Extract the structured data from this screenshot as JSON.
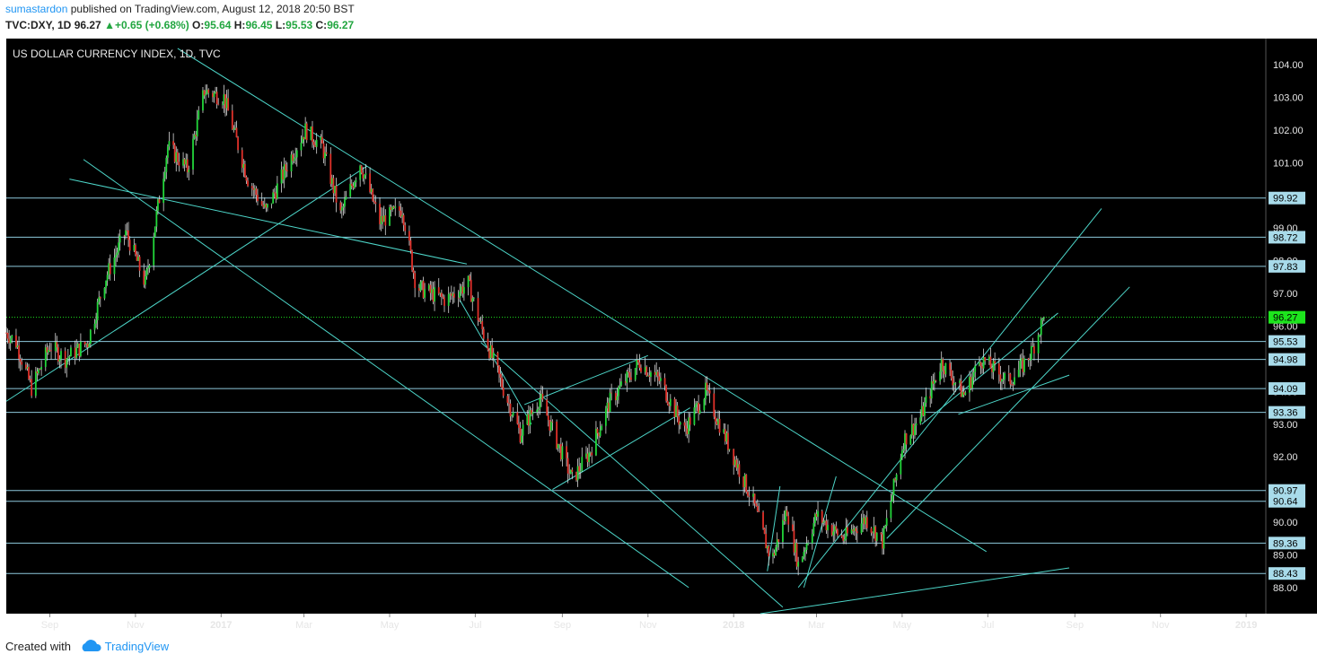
{
  "header": {
    "user": "sumastardon",
    "published_text": "published on TradingView.com, August 12, 2018 20:50 BST",
    "symbol": "TVC:DXY, 1D",
    "last": "96.27",
    "change": "+0.65 (+0.68%)",
    "o_label": "O:",
    "o": "95.64",
    "h_label": "H:",
    "h": "96.45",
    "l_label": "L:",
    "l": "95.53",
    "c_label": "C:",
    "c": "96.27"
  },
  "footer": {
    "created_with": "Created with",
    "brand": "TradingView"
  },
  "colors": {
    "background": "#000000",
    "up": "#22d63a",
    "down": "#e0312a",
    "line": "#4dd6c9",
    "level_line": "#8ec9dd",
    "label_bg": "#a8dbea",
    "last_bg": "#1de51d"
  },
  "chart_data": {
    "type": "candlestick",
    "title": "US DOLLAR CURRENCY INDEX, 1D, TVC",
    "ylim": [
      87.2,
      104.8
    ],
    "y_ticks": [
      104,
      103,
      102,
      101,
      100,
      99,
      98,
      97,
      96,
      95,
      94,
      93,
      92,
      91,
      90,
      89,
      88
    ],
    "x_ticks": [
      {
        "label": "Sep",
        "date": "2016-09-01"
      },
      {
        "label": "Nov",
        "date": "2016-11-01"
      },
      {
        "label": "2017",
        "date": "2017-01-01",
        "bold": true
      },
      {
        "label": "Mar",
        "date": "2017-03-01"
      },
      {
        "label": "May",
        "date": "2017-05-01"
      },
      {
        "label": "Jul",
        "date": "2017-07-01"
      },
      {
        "label": "Sep",
        "date": "2017-09-01"
      },
      {
        "label": "Nov",
        "date": "2017-11-01"
      },
      {
        "label": "2018",
        "date": "2018-01-01",
        "bold": true
      },
      {
        "label": "Mar",
        "date": "2018-03-01"
      },
      {
        "label": "May",
        "date": "2018-05-01"
      },
      {
        "label": "Jul",
        "date": "2018-07-01"
      },
      {
        "label": "Sep",
        "date": "2018-09-01"
      },
      {
        "label": "Nov",
        "date": "2018-11-01"
      },
      {
        "label": "2019",
        "date": "2019-01-01",
        "bold": true
      }
    ],
    "xlim": [
      "2016-08-01",
      "2019-01-15"
    ],
    "price_path": [
      [
        "2016-08-01",
        95.8
      ],
      [
        "2016-08-08",
        95.5
      ],
      [
        "2016-08-19",
        94.1
      ],
      [
        "2016-09-01",
        95.4
      ],
      [
        "2016-09-12",
        95.0
      ],
      [
        "2016-09-28",
        95.5
      ],
      [
        "2016-10-10",
        97.4
      ],
      [
        "2016-10-25",
        98.9
      ],
      [
        "2016-11-08",
        97.3
      ],
      [
        "2016-11-24",
        101.5
      ],
      [
        "2016-12-08",
        100.8
      ],
      [
        "2016-12-20",
        103.2
      ],
      [
        "2017-01-03",
        103.0
      ],
      [
        "2017-01-20",
        100.5
      ],
      [
        "2017-02-02",
        99.5
      ],
      [
        "2017-02-20",
        101.2
      ],
      [
        "2017-03-02",
        102.0
      ],
      [
        "2017-03-14",
        101.5
      ],
      [
        "2017-03-27",
        99.4
      ],
      [
        "2017-04-10",
        101.0
      ],
      [
        "2017-04-24",
        99.2
      ],
      [
        "2017-05-10",
        99.6
      ],
      [
        "2017-05-20",
        97.2
      ],
      [
        "2017-06-10",
        96.8
      ],
      [
        "2017-06-26",
        97.3
      ],
      [
        "2017-07-05",
        96.0
      ],
      [
        "2017-07-20",
        94.2
      ],
      [
        "2017-08-02",
        92.7
      ],
      [
        "2017-08-16",
        93.8
      ],
      [
        "2017-09-08",
        91.3
      ],
      [
        "2017-09-20",
        92.1
      ],
      [
        "2017-10-05",
        93.7
      ],
      [
        "2017-10-26",
        94.9
      ],
      [
        "2017-11-10",
        94.3
      ],
      [
        "2017-11-27",
        92.8
      ],
      [
        "2017-12-12",
        94.0
      ],
      [
        "2018-01-01",
        92.0
      ],
      [
        "2018-01-15",
        90.6
      ],
      [
        "2018-01-28",
        88.8
      ],
      [
        "2018-02-08",
        90.4
      ],
      [
        "2018-02-16",
        88.7
      ],
      [
        "2018-03-01",
        90.2
      ],
      [
        "2018-03-20",
        89.5
      ],
      [
        "2018-04-05",
        90.1
      ],
      [
        "2018-04-17",
        89.4
      ],
      [
        "2018-05-02",
        92.5
      ],
      [
        "2018-05-14",
        93.2
      ],
      [
        "2018-05-29",
        94.9
      ],
      [
        "2018-06-14",
        93.9
      ],
      [
        "2018-06-26",
        95.0
      ],
      [
        "2018-07-16",
        94.3
      ],
      [
        "2018-07-26",
        94.8
      ],
      [
        "2018-08-01",
        95.2
      ],
      [
        "2018-08-10",
        96.27
      ]
    ],
    "level_labels": [
      {
        "value": 99.92,
        "label": "99.92"
      },
      {
        "value": 98.72,
        "label": "98.72"
      },
      {
        "value": 97.83,
        "label": "97.83"
      },
      {
        "value": 95.53,
        "label": "95.53"
      },
      {
        "value": 94.98,
        "label": "94.98"
      },
      {
        "value": 94.09,
        "label": "94.09"
      },
      {
        "value": 93.36,
        "label": "93.36"
      },
      {
        "value": 90.97,
        "label": "90.97"
      },
      {
        "value": 90.64,
        "label": "90.64"
      },
      {
        "value": 89.36,
        "label": "89.36"
      },
      {
        "value": 88.43,
        "label": "88.43"
      }
    ],
    "last_price": {
      "value": 96.27,
      "label": "96.27"
    },
    "trend_lines": [
      [
        [
          "2016-08-01",
          93.7
        ],
        [
          "2017-04-15",
          100.9
        ]
      ],
      [
        [
          "2016-09-25",
          101.1
        ],
        [
          "2017-11-30",
          88.0
        ]
      ],
      [
        [
          "2016-09-15",
          100.5
        ],
        [
          "2017-06-25",
          97.9
        ]
      ],
      [
        [
          "2016-12-01",
          104.5
        ],
        [
          "2018-06-30",
          89.1
        ]
      ],
      [
        [
          "2017-08-05",
          93.6
        ],
        [
          "2017-11-01",
          95.1
        ]
      ],
      [
        [
          "2017-08-25",
          91.0
        ],
        [
          "2017-12-01",
          93.5
        ]
      ],
      [
        [
          "2017-06-20",
          96.8
        ],
        [
          "2017-08-10",
          93.0
        ]
      ],
      [
        [
          "2017-07-05",
          95.5
        ],
        [
          "2018-02-05",
          87.4
        ]
      ],
      [
        [
          "2018-01-20",
          87.2
        ],
        [
          "2018-08-28",
          88.6
        ]
      ],
      [
        [
          "2018-01-25",
          88.5
        ],
        [
          "2018-02-03",
          91.1
        ]
      ],
      [
        [
          "2018-02-20",
          88.0
        ],
        [
          "2018-03-15",
          91.4
        ]
      ],
      [
        [
          "2018-02-16",
          88.0
        ],
        [
          "2018-09-20",
          99.6
        ]
      ],
      [
        [
          "2018-04-20",
          89.5
        ],
        [
          "2018-10-10",
          97.2
        ]
      ],
      [
        [
          "2018-05-15",
          93.0
        ],
        [
          "2018-08-20",
          96.4
        ]
      ],
      [
        [
          "2018-06-10",
          93.3
        ],
        [
          "2018-08-28",
          94.5
        ]
      ]
    ]
  }
}
